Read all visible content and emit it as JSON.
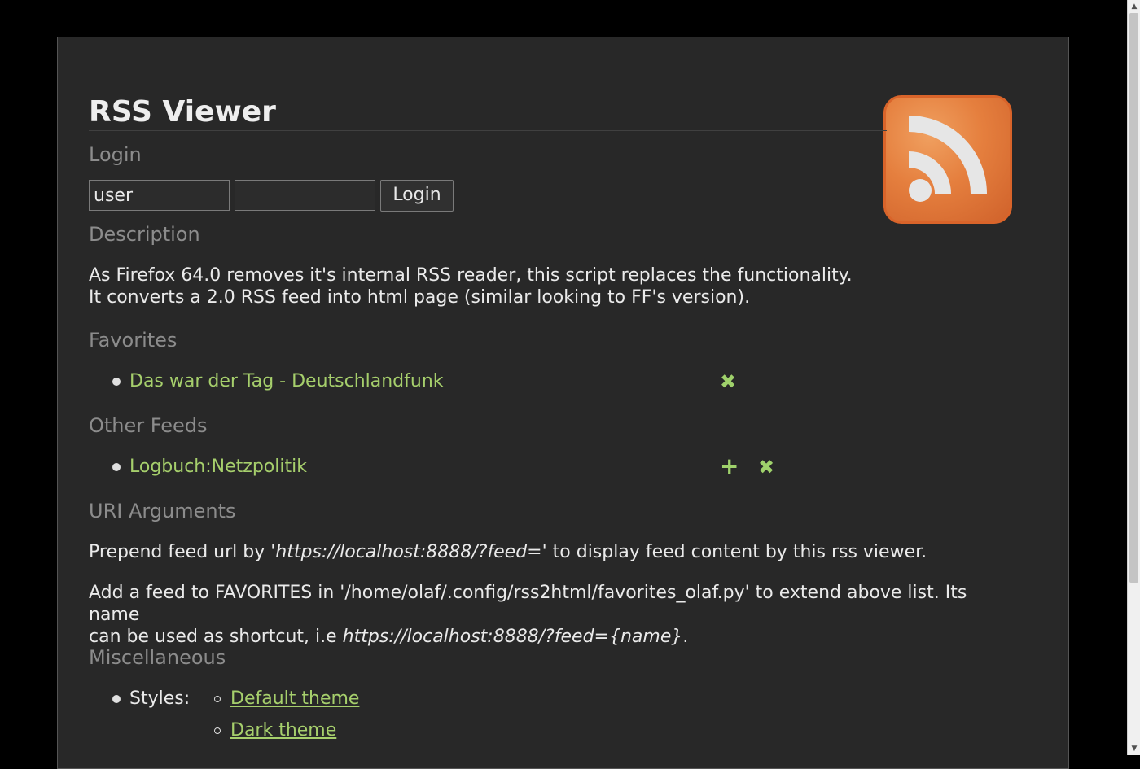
{
  "title": "RSS Viewer",
  "login": {
    "heading": "Login",
    "username_value": "user",
    "password_value": "",
    "button_label": "Login"
  },
  "description": {
    "heading": "Description",
    "line1": "As Firefox 64.0 removes it's internal RSS reader, this script replaces the functionality.",
    "line2": "It converts a 2.0 RSS feed into html page (similar looking to FF's version)."
  },
  "favorites": {
    "heading": "Favorites",
    "items": [
      {
        "label": "Das war der Tag - Deutschlandfunk",
        "remove_icon": "✖"
      }
    ]
  },
  "other_feeds": {
    "heading": "Other Feeds",
    "items": [
      {
        "label": "Logbuch:Netzpolitik",
        "add_icon": "+",
        "remove_icon": "✖"
      }
    ]
  },
  "uri_arguments": {
    "heading": "URI Arguments",
    "p1_before": "Prepend feed url by '",
    "p1_italic": "https://localhost:8888/?feed=",
    "p1_after": "' to display feed content by this rss viewer.",
    "p2_line1": "Add a feed to FAVORITES in '/home/olaf/.config/rss2html/favorites_olaf.py' to extend above list. Its name",
    "p2_line2_before": "can be used as shortcut, i.e ",
    "p2_line2_italic": "https://localhost:8888/?feed={name}",
    "p2_line2_after": "."
  },
  "miscellaneous": {
    "heading": "Miscellaneous",
    "styles_label": "Styles:",
    "themes": [
      "Default theme",
      "Dark theme"
    ]
  },
  "colors": {
    "background": "#282828",
    "link": "#a6cf6c",
    "heading": "#8c8c8c",
    "logo": "#e57f3e"
  },
  "icons": {
    "logo": "rss-feed-icon",
    "remove": "remove-icon",
    "add": "add-icon"
  }
}
